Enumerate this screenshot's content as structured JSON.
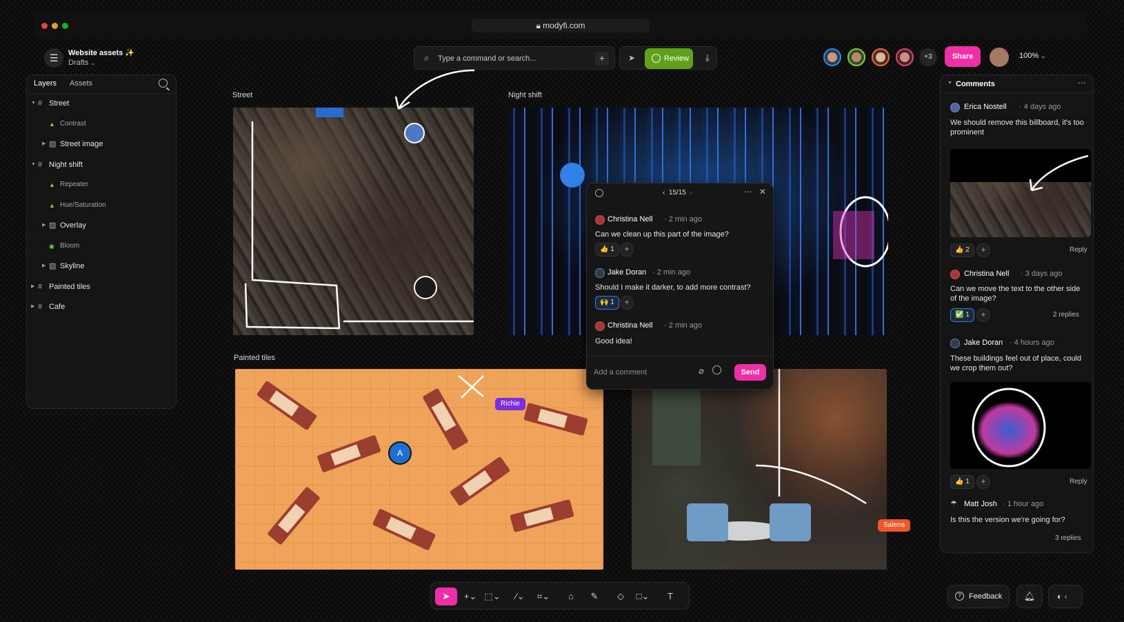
{
  "browser": {
    "url": "modyfi.com",
    "lock_icon": "lock-icon"
  },
  "project": {
    "title": "Website assets",
    "sparkle": "✨",
    "subtitle": "Drafts"
  },
  "command": {
    "placeholder": "Type a command or search..."
  },
  "mode": {
    "review_label": "Review"
  },
  "collaborators": {
    "more_count": "+3",
    "colors": [
      "#3a86e0",
      "#7dd33c",
      "#ee6b3a",
      "#e0436a"
    ]
  },
  "share_label": "Share",
  "zoom_label": "100%",
  "layers": {
    "tabs": [
      "Layers",
      "Assets"
    ],
    "items": [
      {
        "label": "Street",
        "depth": 0,
        "kind": "frame",
        "expanded": true
      },
      {
        "label": "Contrast",
        "depth": 1,
        "kind": "adjust"
      },
      {
        "label": "Street image",
        "depth": 1,
        "kind": "image"
      },
      {
        "label": "Night shift",
        "depth": 0,
        "kind": "frame",
        "expanded": true
      },
      {
        "label": "Repeater",
        "depth": 1,
        "kind": "adjust"
      },
      {
        "label": "Hue/Saturation",
        "depth": 1,
        "kind": "adjust"
      },
      {
        "label": "Overlay",
        "depth": 1,
        "kind": "image"
      },
      {
        "label": "Bloom",
        "depth": 1,
        "kind": "effect"
      },
      {
        "label": "Skyline",
        "depth": 1,
        "kind": "image"
      },
      {
        "label": "Painted tiles",
        "depth": 0,
        "kind": "frame"
      },
      {
        "label": "Cafe",
        "depth": 0,
        "kind": "frame"
      }
    ]
  },
  "frames": {
    "street": "Street",
    "night": "Night shift",
    "tiles": "Painted tiles"
  },
  "cursor_tags": {
    "richie": "Richie",
    "salena": "Salena",
    "pin_a": "A"
  },
  "thread": {
    "counter": "15/15",
    "comments": [
      {
        "name": "Christina Nell",
        "time": "· 2 min ago",
        "text": "Can we clean up this part of the image?",
        "reaction": "👍 1"
      },
      {
        "name": "Jake Doran",
        "time": "· 2 min ago",
        "text": "Should I make it darker, to add more contrast?",
        "reaction": "🙌 1"
      },
      {
        "name": "Christina Nell",
        "time": "· 2 min ago",
        "text": "Good idea!"
      }
    ],
    "input_placeholder": "Add a comment",
    "send_label": "Send"
  },
  "comments_panel": {
    "title": "Comments",
    "items": [
      {
        "name": "Erica Nostell",
        "time": "· 4 days ago",
        "text": "We should remove this billboard, it's too prominent",
        "reaction": "👍 2",
        "action": "Reply"
      },
      {
        "name": "Christina Nell",
        "time": "· 3 days ago",
        "text": "Can we move the text to the other side of the image?",
        "reaction": "✅ 1",
        "action": "2 replies"
      },
      {
        "name": "Jake Doran",
        "time": "· 4 hours ago",
        "text": "These buildings feel out of place, could we crop them out?",
        "reaction": "👍 1",
        "action": "Reply"
      },
      {
        "name": "Matt Josh",
        "time": "· 1 hour ago",
        "text": "Is this the version we're going for?",
        "action": "3 replies"
      }
    ]
  },
  "feedback_label": "Feedback",
  "accent": "#f02ea6",
  "review_color": "#5fa11a"
}
